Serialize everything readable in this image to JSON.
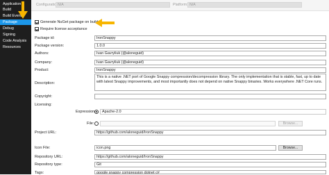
{
  "sidebar": {
    "items": [
      {
        "label": "Application",
        "active": false
      },
      {
        "label": "Build",
        "active": false
      },
      {
        "label": "Build Events",
        "active": false
      },
      {
        "label": "Package",
        "active": true
      },
      {
        "label": "Debug",
        "active": false
      },
      {
        "label": "Signing",
        "active": false
      },
      {
        "label": "Code Analysis",
        "active": false
      },
      {
        "label": "Resources",
        "active": false
      }
    ]
  },
  "topbar": {
    "configuration_label": "Configuration:",
    "configuration_value": "N/A",
    "platform_label": "Platform:",
    "platform_value": "N/A"
  },
  "options": {
    "generate_nuget_label": "Generate NuGet package on build",
    "generate_nuget_checked": true,
    "require_license_label": "Require license acceptance",
    "require_license_checked": true
  },
  "form": {
    "package_id_label": "Package id:",
    "package_id_value": "IronSnappy",
    "package_version_label": "Package version:",
    "package_version_value": "1.0.0",
    "authors_label": "Authors:",
    "authors_value": "Ivan Gavryliuk (@aloneguid)",
    "company_label": "Company:",
    "company_value": "Ivan Gavryliuk (@aloneguid)",
    "product_label": "Product:",
    "product_value": "IronSnappy",
    "description_label": "Description:",
    "description_value": "This is a native .NET port of Google Snappy compression/decompression library. The only implementation that is stable, fast, up to date with latest Snappy improvements, and most importantly does not depend on native Snappy binaries. Works everywhere .NET Core runs.",
    "copyright_label": "Copyright:",
    "copyright_value": "",
    "licensing_label": "Licensing:",
    "expression_label": "Expression:",
    "expression_value": "Apache-2.0",
    "file_label": "File:",
    "file_value": "",
    "browse_disabled_label": "Browse...",
    "project_url_label": "Project URL:",
    "project_url_value": "https://github.com/aloneguid/IronSnappy",
    "icon_file_label": "Icon File:",
    "icon_file_value": "icon.png",
    "browse_label": "Browse...",
    "repository_url_label": "Repository URL:",
    "repository_url_value": "https://github.com/aloneguid/IronSnappy",
    "repository_type_label": "Repository type:",
    "repository_type_value": "Git",
    "tags_label": "Tags:",
    "tags_value": "google snappy compression dotnet c#"
  },
  "colors": {
    "accent": "#1c97ea",
    "sidebar_bg": "#1e1e1e",
    "arrow": "#f7b500"
  }
}
